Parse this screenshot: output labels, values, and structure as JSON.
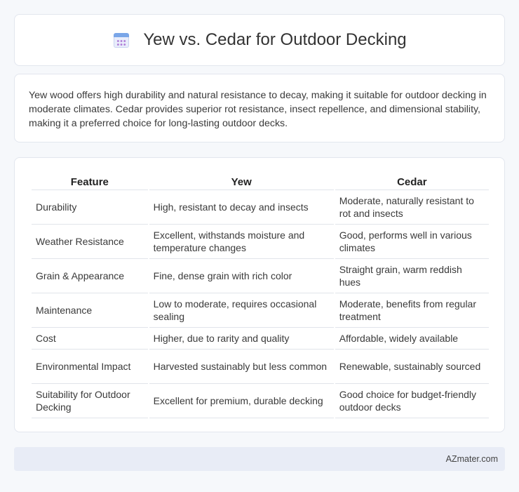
{
  "header": {
    "title": "Yew vs. Cedar for Outdoor Decking",
    "icon": "calendar-icon"
  },
  "summary": {
    "text": "Yew wood offers high durability and natural resistance to decay, making it suitable for outdoor decking in moderate climates. Cedar provides superior rot resistance, insect repellence, and dimensional stability, making it a preferred choice for long-lasting outdoor decks."
  },
  "table": {
    "headers": [
      "Feature",
      "Yew",
      "Cedar"
    ],
    "rows": [
      [
        "Durability",
        "High, resistant to decay and insects",
        "Moderate, naturally resistant to rot and insects"
      ],
      [
        "Weather Resistance",
        "Excellent, withstands moisture and temperature changes",
        "Good, performs well in various climates"
      ],
      [
        "Grain & Appearance",
        "Fine, dense grain with rich color",
        "Straight grain, warm reddish hues"
      ],
      [
        "Maintenance",
        "Low to moderate, requires occasional sealing",
        "Moderate, benefits from regular treatment"
      ],
      [
        "Cost",
        "Higher, due to rarity and quality",
        "Affordable, widely available"
      ],
      [
        "Environmental Impact",
        "Harvested sustainably but less common",
        "Renewable, sustainably sourced"
      ],
      [
        "Suitability for Outdoor Decking",
        "Excellent for premium, durable decking",
        "Good choice for budget-friendly outdoor decks"
      ]
    ]
  },
  "footer": {
    "brand": "AZmater.com"
  }
}
